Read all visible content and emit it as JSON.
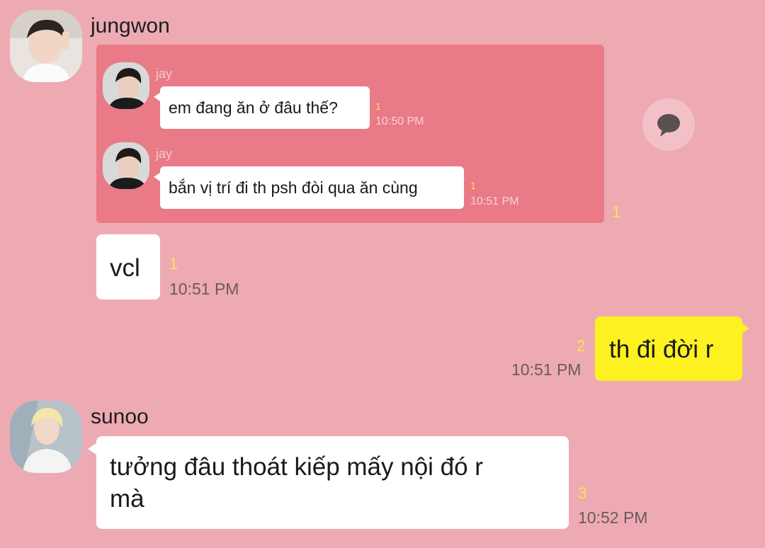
{
  "messages": {
    "jungwon": {
      "sender": "jungwon",
      "quoted": [
        {
          "sender": "jay",
          "text": "em đang ăn ở đâu thế?",
          "unread": "1",
          "time": "10:50 PM"
        },
        {
          "sender": "jay",
          "text": "bắn vị trí đi th psh đòi qua ăn cùng",
          "unread": "1",
          "time": "10:51 PM"
        }
      ],
      "forward_unread": "1",
      "msg2": {
        "text": "vcl",
        "unread": "1",
        "time": "10:51 PM"
      }
    },
    "me": {
      "text": "th đi đời r",
      "unread": "2",
      "time": "10:51 PM"
    },
    "sunoo": {
      "sender": "sunoo",
      "text_line1": "tưởng đâu thoát kiếp mấy nội đó r",
      "text_line2": "mà",
      "unread": "3",
      "time": "10:52 PM"
    }
  },
  "icons": {
    "reply": "speech-bubble-icon"
  },
  "colors": {
    "background": "#eeaab3",
    "my_bubble": "#fdf121",
    "quote_box": "#e97a86"
  }
}
